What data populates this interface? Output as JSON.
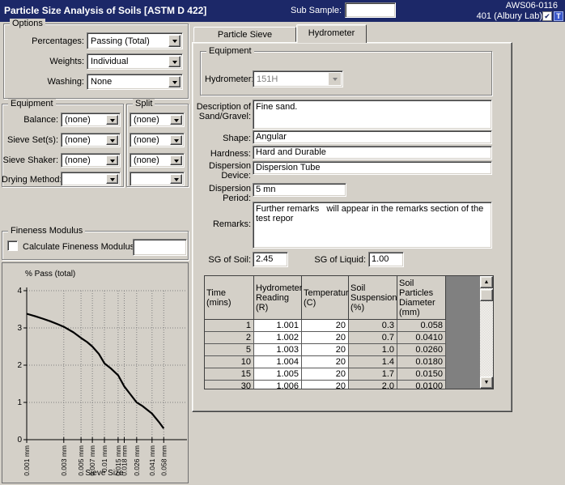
{
  "window": {
    "title": "Particle Size Analysis of Soils [ASTM D 422]",
    "sub_sample_label": "Sub Sample:",
    "sub_sample_value": "",
    "sample_id": "AWS06-0116",
    "lab": "401 (Albury Lab)",
    "check_icon_glyph": "✔",
    "t_icon_glyph": "T",
    "titlebar_color": "#1c2868"
  },
  "options": {
    "legend": "Options",
    "fields": [
      {
        "label": "Percentages:",
        "value": "Passing (Total)"
      },
      {
        "label": "Weights:",
        "value": "Individual"
      },
      {
        "label": "Washing:",
        "value": "None"
      }
    ]
  },
  "equipment_left": {
    "legend": "Equipment",
    "split_legend": "Split",
    "rows": [
      {
        "label": "Balance:",
        "value": "(none)",
        "split": "(none)"
      },
      {
        "label": "Sieve Set(s):",
        "value": "(none)",
        "split": "(none)"
      },
      {
        "label": "Sieve Shaker:",
        "value": "(none)",
        "split": "(none)"
      },
      {
        "label": "Drying Method:",
        "value": "",
        "split": ""
      }
    ]
  },
  "fineness": {
    "legend": "Fineness Modulus",
    "checkbox_label": "Calculate Fineness Modulus.",
    "checked": false,
    "value": ""
  },
  "tabs": [
    {
      "label": "Particle Sieve Distribution",
      "active": false
    },
    {
      "label": "Hydrometer",
      "active": true
    }
  ],
  "hydrometer_tab": {
    "equipment_legend": "Equipment",
    "hydrometer_label": "Hydrometer:",
    "hydrometer_value": "151H",
    "fields": {
      "desc_label": "Description of Sand/Gravel:",
      "desc_value": "Fine sand.",
      "shape_label": "Shape:",
      "shape_value": "Angular",
      "hardness_label": "Hardness:",
      "hardness_value": "Hard and Durable",
      "disp_device_label": "Dispersion Device:",
      "disp_device_value": "Dispersion Tube",
      "disp_period_label": "Dispersion Period:",
      "disp_period_value": "5 mn",
      "remarks_label": "Remarks:",
      "remarks_value": "Further remarks   will appear in the remarks section of the test repor"
    },
    "sg_soil_label": "SG of Soil:",
    "sg_soil_value": "2.45",
    "sg_liquid_label": "SG of Liquid:",
    "sg_liquid_value": "1.00",
    "table": {
      "columns": [
        "Time (mins)",
        "Hydrometer Reading (R)",
        "Temperature (C)",
        "Soil Suspension (%)",
        "Soil Particles Diameter (mm)"
      ],
      "rows": [
        [
          "1",
          "1.001",
          "20",
          "0.3",
          "0.058"
        ],
        [
          "2",
          "1.002",
          "20",
          "0.7",
          "0.0410"
        ],
        [
          "5",
          "1.003",
          "20",
          "1.0",
          "0.0260"
        ],
        [
          "10",
          "1.004",
          "20",
          "1.4",
          "0.0180"
        ],
        [
          "15",
          "1.005",
          "20",
          "1.7",
          "0.0150"
        ],
        [
          "30",
          "1.006",
          "20",
          "2.0",
          "0.0100"
        ]
      ]
    }
  },
  "chart_data": {
    "type": "line",
    "title": "% Pass (total)",
    "xlabel": "Sieve Size",
    "ylabel": "% Pass (total)",
    "x_scale": "log",
    "xlim": [
      0.001,
      0.1
    ],
    "ylim": [
      0,
      4
    ],
    "y_ticks": [
      0,
      1,
      2,
      3,
      4
    ],
    "x_tick_values": [
      0.001,
      0.003,
      0.005,
      0.007,
      0.01,
      0.015,
      0.018,
      0.026,
      0.041,
      0.058
    ],
    "x_tick_labels": [
      "0.001 mm",
      "0.003 mm",
      "0.005 mm",
      "0.007 mm",
      "0.01 mm",
      "0.015 mm",
      "0.018 mm",
      "0.026 mm",
      "0.041 mm",
      "0.058 mm"
    ],
    "grid": "dotted",
    "line_color": "#000000",
    "points": [
      [
        0.001,
        3.38
      ],
      [
        0.0013,
        3.31
      ],
      [
        0.0016,
        3.25
      ],
      [
        0.002,
        3.18
      ],
      [
        0.0025,
        3.1
      ],
      [
        0.003,
        3.03
      ],
      [
        0.004,
        2.88
      ],
      [
        0.005,
        2.73
      ],
      [
        0.006,
        2.62
      ],
      [
        0.007,
        2.5
      ],
      [
        0.0085,
        2.3
      ],
      [
        0.01,
        2.05
      ],
      [
        0.012,
        1.92
      ],
      [
        0.015,
        1.73
      ],
      [
        0.018,
        1.43
      ],
      [
        0.021,
        1.25
      ],
      [
        0.026,
        1.0
      ],
      [
        0.031,
        0.9
      ],
      [
        0.041,
        0.7
      ],
      [
        0.05,
        0.48
      ],
      [
        0.058,
        0.3
      ]
    ]
  }
}
